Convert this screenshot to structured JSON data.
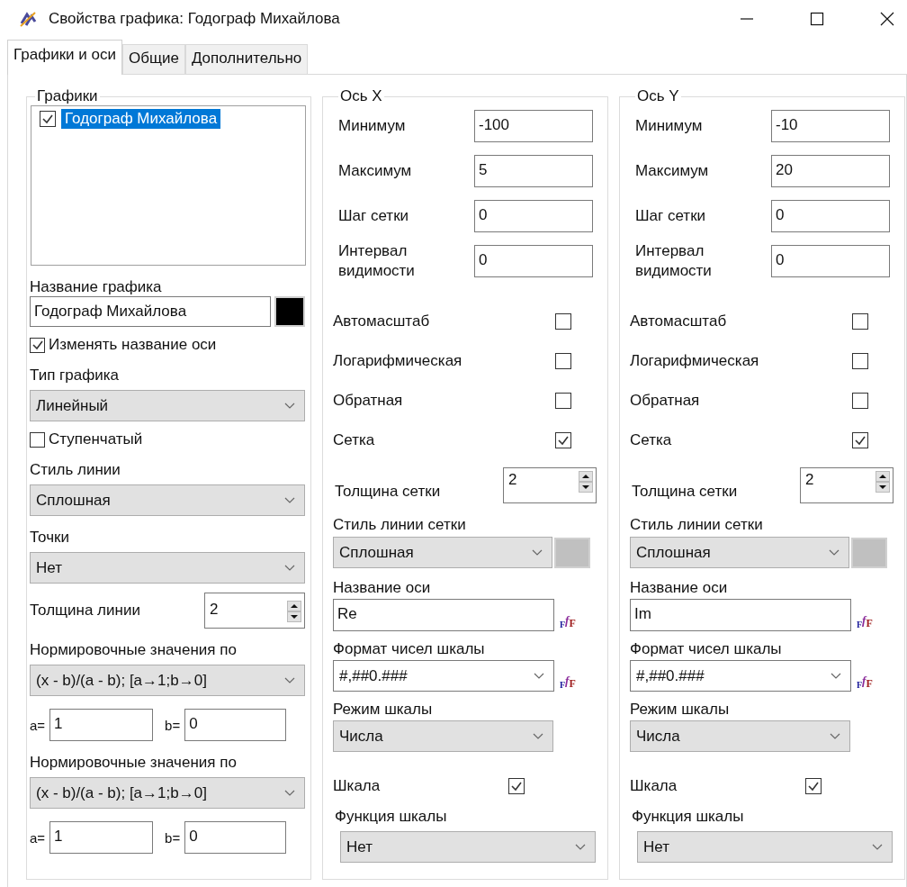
{
  "window": {
    "title": "Свойства графика: Годограф Михайлова"
  },
  "tabs": [
    {
      "label": "Графики и оси",
      "selected": true
    },
    {
      "label": "Общие",
      "selected": false
    },
    {
      "label": "Дополнительно",
      "selected": false
    }
  ],
  "plots_panel": {
    "title": "Графики",
    "plots": [
      {
        "label": "Годограф Михайлова",
        "checked": true,
        "selected": true
      }
    ],
    "fields": [
      {
        "kind": "text",
        "label": "Название графика",
        "value": "Годограф Михайлова"
      },
      {
        "kind": "checkbox",
        "label": "Изменять название оси",
        "checked": true
      },
      {
        "kind": "select",
        "label": "Тип графика",
        "value": "Линейный"
      },
      {
        "kind": "checkbox",
        "label": "Ступенчатый",
        "checked": false
      },
      {
        "kind": "select",
        "label": "Стиль линии",
        "value": "Сплошная"
      },
      {
        "kind": "select",
        "label": "Точки",
        "value": "Нет"
      },
      {
        "kind": "spinner",
        "label": "Толщина линии",
        "value": "2"
      },
      {
        "kind": "select",
        "label": "Нормировочные значения по",
        "value": "(x - b)/(a - b);  [a→1;b→0]"
      },
      {
        "kind": "pair",
        "a_label": "a=",
        "a_value": "1",
        "b_label": "b=",
        "b_value": "0"
      },
      {
        "kind": "select",
        "label": "Нормировочные значения по",
        "value": "(x - b)/(a - b);  [a→1;b→0]"
      },
      {
        "kind": "pair",
        "a_label": "a=",
        "a_value": "1",
        "b_label": "b=",
        "b_value": "0"
      }
    ]
  },
  "axes": [
    {
      "title": "Ось X",
      "ranges": [
        {
          "label": "Минимум",
          "value": "-100"
        },
        {
          "label": "Максимум",
          "value": "5"
        },
        {
          "label": "Шаг сетки",
          "value": "0"
        },
        {
          "label": "Интервал видимости",
          "value": "0"
        }
      ],
      "options": [
        {
          "label": "Автомасштаб",
          "checked": false
        },
        {
          "label": "Логарифмическая",
          "checked": false
        },
        {
          "label": "Обратная",
          "checked": false
        },
        {
          "label": "Сетка",
          "checked": true
        }
      ],
      "grid_width": {
        "label": "Толщина  сетки",
        "value": "2"
      },
      "grid_style": {
        "label": "Стиль линии сетки",
        "value": "Сплошная"
      },
      "axis_name": {
        "label": "Название оси",
        "value": "Re",
        "font_button": [
          "F",
          "f",
          "F"
        ]
      },
      "number_format": {
        "label": "Формат чисел шкалы",
        "value": "#,##0.###",
        "font_button": [
          "F",
          "f",
          "F"
        ]
      },
      "scale_mode": {
        "label": "Режим шкалы",
        "value": "Числа"
      },
      "scale": {
        "label": "Шкала",
        "checked": true
      },
      "scale_function": {
        "label": "Функция шкалы",
        "value": "Нет"
      }
    },
    {
      "title": "Ось Y",
      "ranges": [
        {
          "label": "Минимум",
          "value": "-10"
        },
        {
          "label": "Максимум",
          "value": "20"
        },
        {
          "label": "Шаг сетки",
          "value": "0"
        },
        {
          "label": "Интервал видимости",
          "value": "0"
        }
      ],
      "options": [
        {
          "label": "Автомасштаб",
          "checked": false
        },
        {
          "label": "Логарифмическая",
          "checked": false
        },
        {
          "label": "Обратная",
          "checked": false
        },
        {
          "label": "Сетка",
          "checked": true
        }
      ],
      "grid_width": {
        "label": "Толщина  сетки",
        "value": "2"
      },
      "grid_style": {
        "label": "Стиль линии сетки",
        "value": "Сплошная"
      },
      "axis_name": {
        "label": "Название оси",
        "value": "Im",
        "font_button": [
          "F",
          "f",
          "F"
        ]
      },
      "number_format": {
        "label": "Формат чисел шкалы",
        "value": "#,##0.###",
        "font_button": [
          "F",
          "f",
          "F"
        ]
      },
      "scale_mode": {
        "label": "Режим шкалы",
        "value": "Числа"
      },
      "scale": {
        "label": "Шкала",
        "checked": true
      },
      "scale_function": {
        "label": "Функция шкалы",
        "value": "Нет"
      }
    }
  ]
}
